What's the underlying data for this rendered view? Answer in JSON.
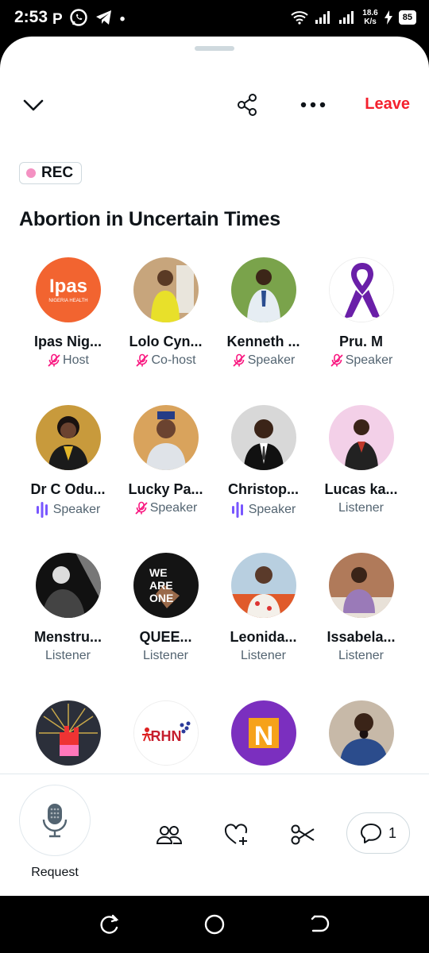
{
  "status_bar": {
    "time": "2:53",
    "left_icons": [
      "P",
      "whatsapp-icon",
      "telegram-icon",
      "•"
    ],
    "net_speed_value": "18.6",
    "net_speed_unit": "K/s",
    "battery": "85"
  },
  "header": {
    "leave_label": "Leave"
  },
  "rec_label": "REC",
  "space_title": "Abortion in Uncertain Times",
  "participants": [
    {
      "name": "Ipas Nig...",
      "role": "Host",
      "role_icon": "mic-off-icon",
      "avatar_color": "#f26430",
      "avatar_text": "Ipas"
    },
    {
      "name": "Lolo Cyn...",
      "role": "Co-host",
      "role_icon": "mic-off-icon",
      "avatar_color": "#c7a57c"
    },
    {
      "name": "Kenneth ...",
      "role": "Speaker",
      "role_icon": "mic-off-icon",
      "avatar_color": "#7aa34b"
    },
    {
      "name": "Pru. M",
      "role": "Speaker",
      "role_icon": "mic-off-icon",
      "avatar_color": "#ffffff"
    },
    {
      "name": "Dr C Odu...",
      "role": "Speaker",
      "role_icon": "audio-bars-icon",
      "avatar_color": "#c89a3c"
    },
    {
      "name": "Lucky Pa...",
      "role": "Speaker",
      "role_icon": "mic-off-icon",
      "avatar_color": "#d9a35c"
    },
    {
      "name": "Christop...",
      "role": "Speaker",
      "role_icon": "audio-bars-icon",
      "avatar_color": "#d8d8d8"
    },
    {
      "name": "Lucas ka...",
      "role": "Listener",
      "role_icon": "",
      "avatar_color": "#f3d0e8"
    },
    {
      "name": "Menstru...",
      "role": "Listener",
      "role_icon": "",
      "avatar_color": "#3a3a3a"
    },
    {
      "name": "QUEE...",
      "role": "Listener",
      "role_icon": "",
      "avatar_color": "#141414",
      "avatar_text": "WE ARE ONE"
    },
    {
      "name": "Leonida...",
      "role": "Listener",
      "role_icon": "",
      "avatar_color": "#b8cfe0"
    },
    {
      "name": "Issabela...",
      "role": "Listener",
      "role_icon": "",
      "avatar_color": "#b07a5a"
    },
    {
      "name": "",
      "role": "",
      "role_icon": "",
      "avatar_color": "#2b2f3a"
    },
    {
      "name": "",
      "role": "",
      "role_icon": "",
      "avatar_color": "#ffffff",
      "avatar_text": "RHN"
    },
    {
      "name": "",
      "role": "",
      "role_icon": "",
      "avatar_color": "#7b2fbf",
      "avatar_text": "N"
    },
    {
      "name": "",
      "role": "",
      "role_icon": "",
      "avatar_color": "#9aa6b8"
    }
  ],
  "bottom_bar": {
    "request_label": "Request",
    "comment_count": "1"
  },
  "colors": {
    "accent_red": "#f4212e",
    "speaker_purple": "#7856ff",
    "mute_pink": "#f91880",
    "text_primary": "#0f1419",
    "text_secondary": "#536471"
  }
}
